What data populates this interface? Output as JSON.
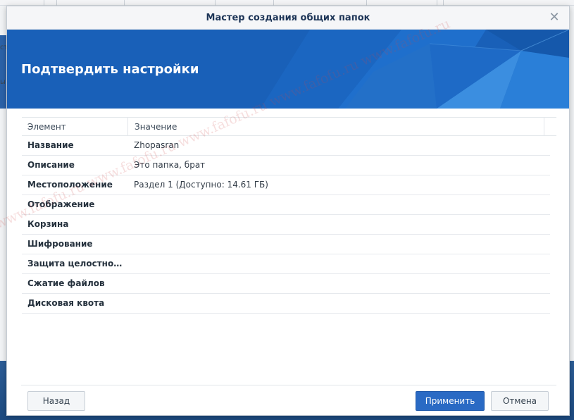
{
  "dialog": {
    "title": "Мастер создания общих папок",
    "heading": "Подтвердить настройки"
  },
  "table": {
    "col_item": "Элемент",
    "col_value": "Значение",
    "rows": [
      {
        "key": "Название",
        "value": "Zhopasran"
      },
      {
        "key": "Описание",
        "value": "Это папка, брат"
      },
      {
        "key": "Местоположение",
        "value": "Раздел 1 (Доступно: 14.61 ГБ)"
      },
      {
        "key": "Отображение",
        "value": ""
      },
      {
        "key": "Корзина",
        "value": ""
      },
      {
        "key": "Шифрование",
        "value": ""
      },
      {
        "key": "Защита целостнос…",
        "value": ""
      },
      {
        "key": "Сжатие файлов",
        "value": ""
      },
      {
        "key": "Дисковая квота",
        "value": ""
      }
    ]
  },
  "buttons": {
    "back": "Назад",
    "apply": "Применить",
    "cancel": "Отмена"
  },
  "background": {
    "left_text_1": "ст",
    "left_text_2": "ы"
  },
  "watermark": "www.fafofu.ru www.fafofu.ru www.fafofu.ru www.fafofu.ru www.fafofu.ru",
  "colors": {
    "banner": "#1960b8",
    "primary_button": "#2a6ac4",
    "watermark": "#cd4646"
  }
}
